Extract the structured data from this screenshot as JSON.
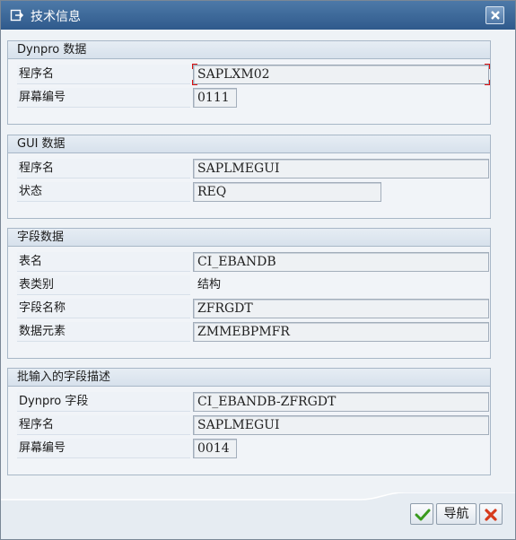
{
  "window": {
    "title": "技术信息",
    "title_icon": "window-export-icon",
    "close_icon": "close-icon"
  },
  "groups": [
    {
      "header": "Dynpro 数据",
      "rows": [
        {
          "label": "程序名",
          "value": "SAPLXM02"
        },
        {
          "label": "屏幕编号",
          "value": "0111"
        }
      ]
    },
    {
      "header": "GUI 数据",
      "rows": [
        {
          "label": "程序名",
          "value": "SAPLMEGUI"
        },
        {
          "label": "状态",
          "value": "REQ"
        }
      ]
    },
    {
      "header": "字段数据",
      "rows": [
        {
          "label": "表名",
          "value": "CI_EBANDB"
        },
        {
          "label": "表类别",
          "value": "结构"
        },
        {
          "label": "字段名称",
          "value": "ZFRGDT"
        },
        {
          "label": "数据元素",
          "value": "ZMMEBPMFR"
        }
      ]
    },
    {
      "header": "批输入的字段描述",
      "rows": [
        {
          "label": "Dynpro 字段",
          "value": "CI_EBANDB-ZFRGDT"
        },
        {
          "label": "程序名",
          "value": "SAPLMEGUI"
        },
        {
          "label": "屏幕编号",
          "value": "0014"
        }
      ]
    }
  ],
  "buttons": {
    "confirm_icon": "checkmark-icon",
    "navigate_label": "导航",
    "cancel_icon": "cancel-x-icon"
  },
  "colors": {
    "titlebar": "#3b6898",
    "confirm": "#3a9a1e",
    "cancel": "#d63a1c",
    "focus_marker": "#dd1111"
  }
}
